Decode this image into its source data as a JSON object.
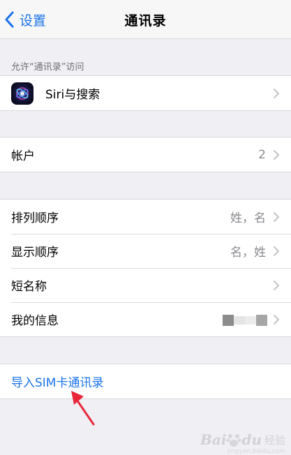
{
  "navbar": {
    "back_label": "设置",
    "title": "通讯录"
  },
  "section_allow": {
    "header": "允许“通讯录”访问",
    "items": [
      {
        "label": "Siri与搜索",
        "icon": "siri-icon"
      }
    ]
  },
  "section_accounts": {
    "items": [
      {
        "label": "帐户",
        "value": "2"
      }
    ]
  },
  "section_prefs": {
    "items": [
      {
        "label": "排列顺序",
        "value": "姓，名"
      },
      {
        "label": "显示顺序",
        "value": "名，姓"
      },
      {
        "label": "短名称",
        "value": ""
      },
      {
        "label": "我的信息",
        "value": ""
      }
    ]
  },
  "section_import": {
    "items": [
      {
        "label": "导入SIM卡通讯录"
      }
    ]
  },
  "watermark": {
    "bai": "Bai",
    "du": "du",
    "jingyan": "经验",
    "url": "jingyan.baidu.com"
  },
  "colors": {
    "accent": "#1a73e8",
    "background": "#efeff4",
    "annotation_arrow": "#e8273a"
  }
}
